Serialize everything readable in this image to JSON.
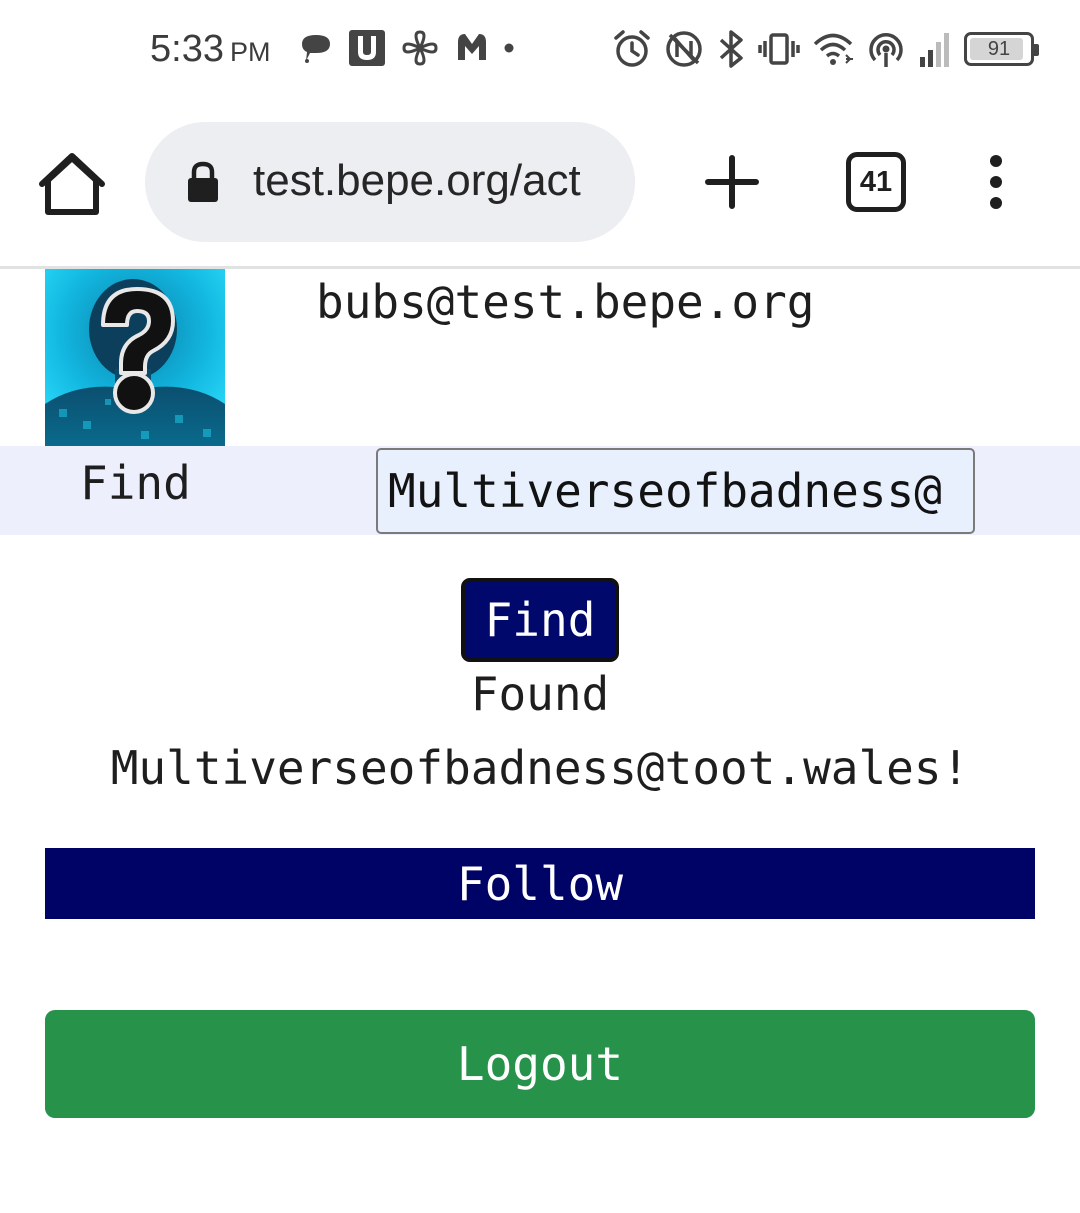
{
  "status_bar": {
    "time": "5:33",
    "ampm": "PM",
    "battery_level": "91",
    "battery_fraction": 0.91,
    "left_icons": [
      "chat-bubble-icon",
      "u-app-icon",
      "pinwheel-icon",
      "malwarebytes-icon",
      "more-notifications-dot-icon"
    ],
    "right_icons": [
      "alarm-icon",
      "nfc-icon",
      "bluetooth-icon",
      "vibrate-icon",
      "wifi-icon",
      "hotspot-icon",
      "cell-signal-icon",
      "battery-icon"
    ]
  },
  "browser": {
    "url": "test.bepe.org/act",
    "tab_count": "41",
    "icons": [
      "home-icon",
      "lock-icon",
      "plus-icon",
      "tab-switcher-icon",
      "more-vert-icon"
    ]
  },
  "page": {
    "user_email": "bubs@test.bepe.org",
    "find_label": "Find",
    "find_input_value": "Multiverseofbadness@",
    "find_button_label": "Find",
    "found_line1": "Found",
    "found_line2": "Multiverseofbadness@toot.wales!",
    "follow_button_label": "Follow",
    "logout_button_label": "Logout"
  },
  "colors": {
    "find_row_bg": "#eeeffd",
    "input_bg": "#e8f0fe",
    "find_button_bg": "#00086b",
    "follow_button_bg": "#000366",
    "logout_button_bg": "#26924a",
    "omnibox_bg": "#eceef1"
  }
}
